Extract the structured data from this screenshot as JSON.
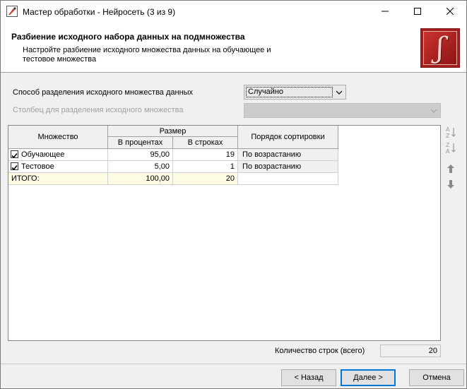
{
  "window": {
    "title": "Мастер обработки - Нейросеть (3 из 9)"
  },
  "header": {
    "title": "Разбиение исходного набора данных на подмножества",
    "subtitle": "Настройте разбиение исходного множества данных на обучающее и тестовое множества"
  },
  "form": {
    "method_label": "Способ разделения исходного множества данных",
    "method_value": "Случайно",
    "column_label": "Столбец для разделения исходного множества",
    "column_value": ""
  },
  "grid": {
    "headers": {
      "set": "Множество",
      "size": "Размер",
      "percent": "В процентах",
      "rows": "В строках",
      "sort": "Порядок сортировки"
    },
    "rows": [
      {
        "name": "Обучающее",
        "checked": true,
        "percent": "95,00",
        "rows": "19",
        "sort": "По возрастанию"
      },
      {
        "name": "Тестовое",
        "checked": true,
        "percent": "5,00",
        "rows": "1",
        "sort": "По возрастанию"
      }
    ],
    "total": {
      "name": "ИТОГО:",
      "percent": "100,00",
      "rows": "20",
      "sort": ""
    }
  },
  "footer": {
    "count_label": "Количество строк (всего)",
    "count_value": "20",
    "back_label": "< Назад",
    "next_label": "Далее >",
    "cancel_label": "Отмена"
  },
  "colors": {
    "accent": "#0078d7",
    "logo": "#a31d1d",
    "total_row": "#fdfbe3"
  }
}
